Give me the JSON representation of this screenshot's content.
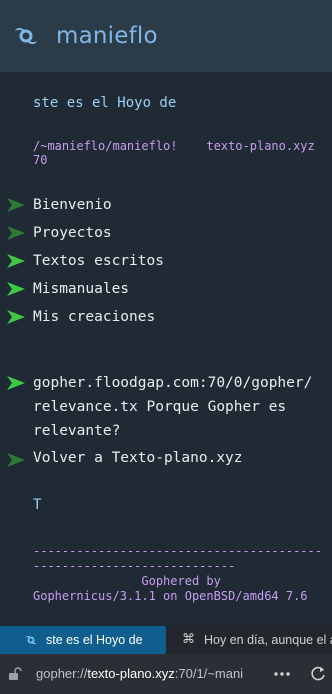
{
  "header": {
    "title": "manieflo",
    "logo_icon": "hurricane-icon",
    "accent": "#7fb6e8"
  },
  "content": {
    "intro": "ste es el Hoyo de",
    "path_line1": "/~manieflo/manieflo!    texto-plano.xyz",
    "path_line2": "70",
    "menu": [
      {
        "label": "Bienvenio"
      },
      {
        "label": "Proyectos"
      },
      {
        "label": "Textos escritos"
      },
      {
        "label": "Mismanuales"
      },
      {
        "label": "Mis creaciones"
      }
    ],
    "link": {
      "line1": "gopher.floodgap.com:70/0/gopher/",
      "line2": "relevance.tx Porque Gopher es",
      "line3": "relevante?"
    },
    "back": "Volver a Texto-plano.xyz",
    "t_char": "T",
    "footer": {
      "rule1": "----------------------------------------",
      "rule2": "----------------------------",
      "line1": "               Gophered by",
      "line2": "Gophernicus/3.1.1 on OpenBSD/amd64 7.6"
    },
    "arrow_color": "#3fc845",
    "arrow_dim_color": "#2e7a34"
  },
  "tabs": [
    {
      "label": "ste es el Hoyo de",
      "icon": "hurricane-icon",
      "active": true
    },
    {
      "label": "Hoy en día, aunque el a...",
      "icon": "command-icon",
      "active": false
    }
  ],
  "urlbar": {
    "scheme": "gopher://",
    "host": "texto-plano.xyz",
    "rest": ":70/1/~mani",
    "lock_icon": "unlock-icon",
    "more_icon": "more-dots-icon",
    "reload_icon": "reload-icon"
  }
}
